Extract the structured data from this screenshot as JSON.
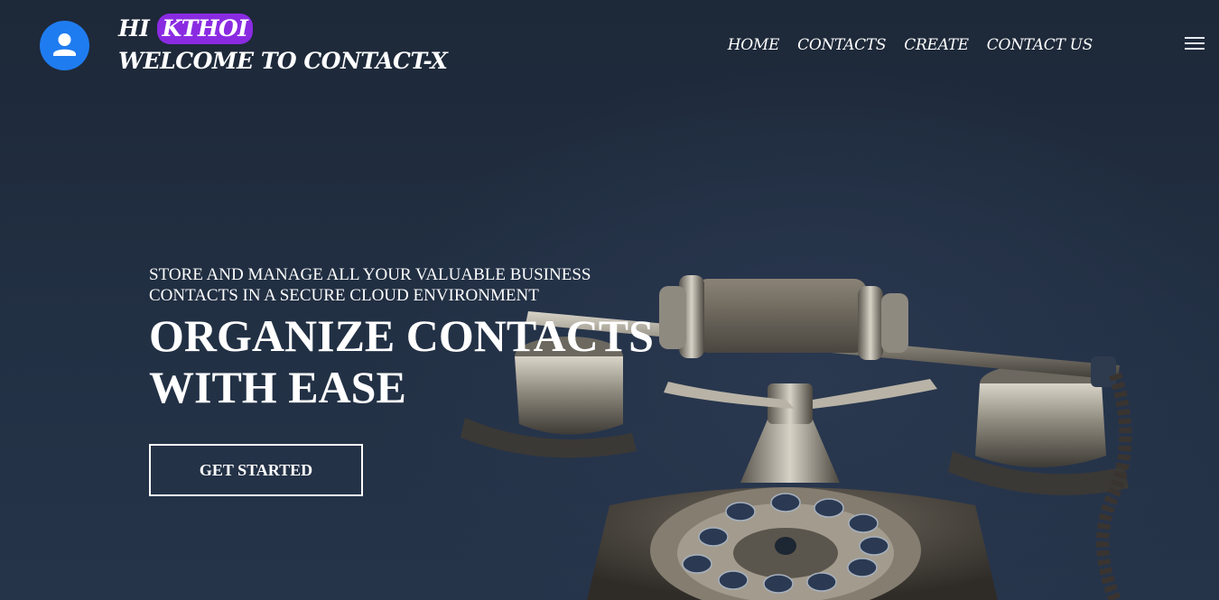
{
  "header": {
    "greeting_prefix": "HI",
    "username": "KTHOI",
    "welcome": "WELCOME TO CONTACT-X",
    "avatar_icon": "user-icon",
    "menu_icon": "hamburger-menu-icon"
  },
  "nav": {
    "items": [
      "HOME",
      "CONTACTS",
      "CREATE",
      "CONTACT US"
    ]
  },
  "hero": {
    "tagline": "STORE AND MANAGE ALL YOUR VALUABLE BUSINESS CONTACTS IN A SECURE CLOUD ENVIRONMENT",
    "headline_line1": "ORGANIZE CONTACTS",
    "headline_line2": "WITH EASE",
    "cta_label": "GET STARTED",
    "image": "vintage-rotary-telephone-image"
  },
  "colors": {
    "background": "#1c2838",
    "avatar": "#1f7cf0",
    "username_highlight": "#8a2be2",
    "text": "#ffffff"
  }
}
